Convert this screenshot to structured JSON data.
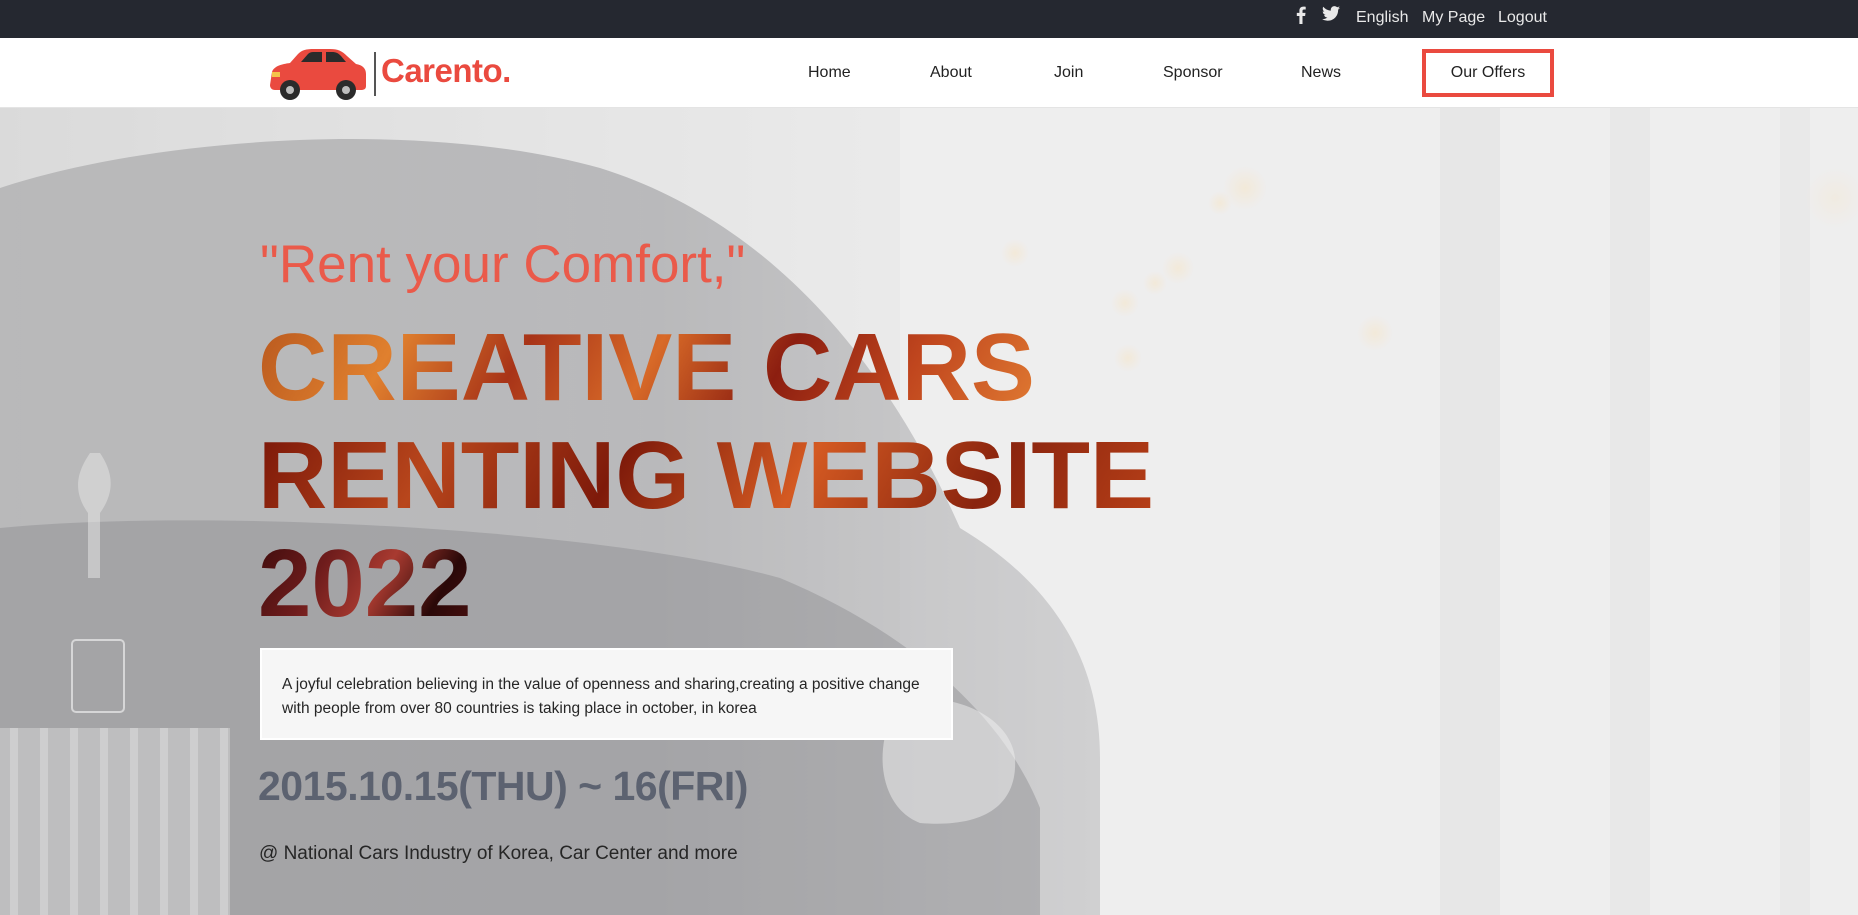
{
  "topbar": {
    "facebook_icon": "facebook-icon",
    "twitter_icon": "twitter-icon",
    "language": "English",
    "my_page": "My Page",
    "logout": "Logout"
  },
  "brand": {
    "name": "Carento.",
    "logo_icon": "car-icon",
    "accent_color": "#ea4a3f"
  },
  "nav": {
    "items": [
      {
        "label": "Home"
      },
      {
        "label": "About"
      },
      {
        "label": "Join"
      },
      {
        "label": "Sponsor"
      },
      {
        "label": "News"
      }
    ],
    "cta_label": "Our Offers"
  },
  "hero": {
    "tagline": "\"Rent your Comfort,\"",
    "headline_line1": "CREATIVE CARS",
    "headline_line2": "RENTING WEBSITE",
    "headline_line3": "2022",
    "description": "A joyful celebration believing in the value of openness and sharing,creating a positive change with people from over 80 countries is taking place in october, in korea",
    "dates": "2015.10.15(THU) ~ 16(FRI)",
    "venue": "@ National Cars Industry of Korea, Car Center and more"
  }
}
